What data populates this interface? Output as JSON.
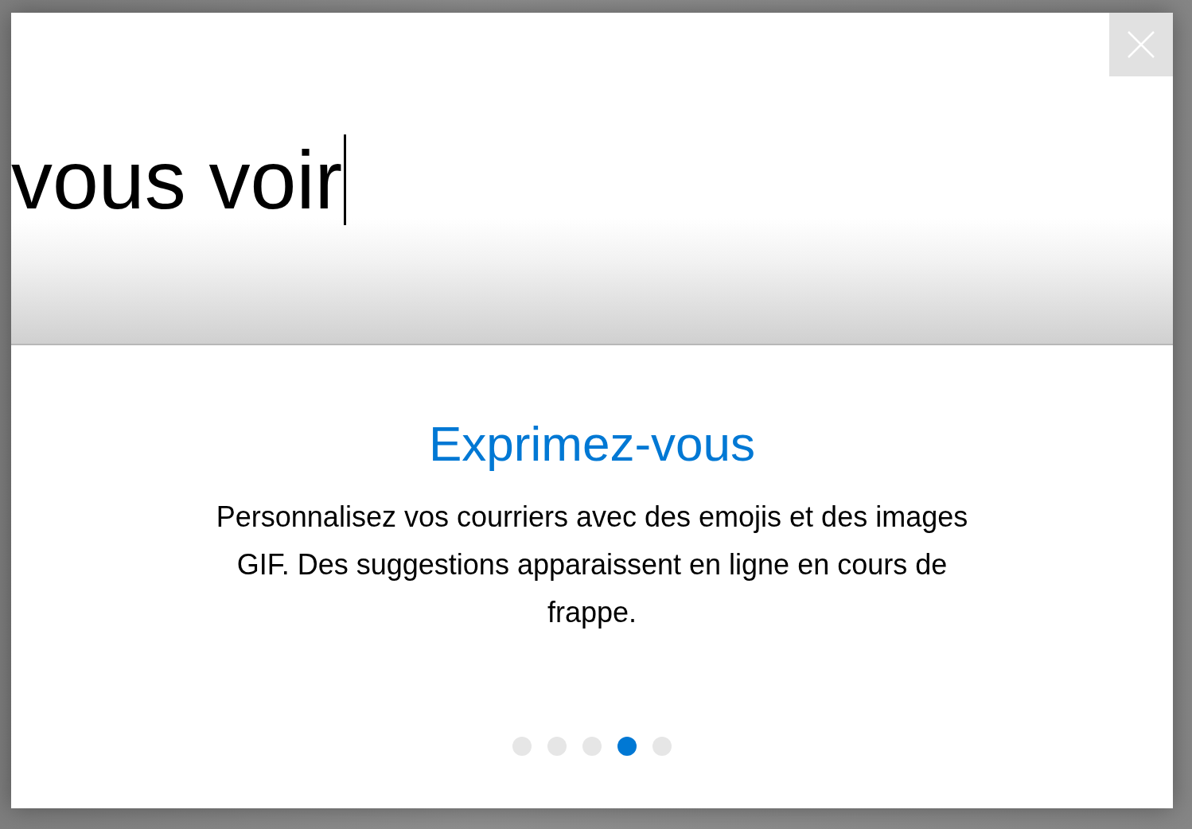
{
  "dialog": {
    "preview": {
      "typed_text": "vous voir",
      "caret": true
    },
    "title": "Exprimez-vous",
    "description": "Personnalisez vos courriers avec des emojis et des images GIF. Des suggestions apparaissent en ligne en cours de frappe.",
    "pager": [
      {
        "selected": false
      },
      {
        "selected": false
      },
      {
        "selected": false
      },
      {
        "selected": true
      },
      {
        "selected": false
      }
    ]
  }
}
